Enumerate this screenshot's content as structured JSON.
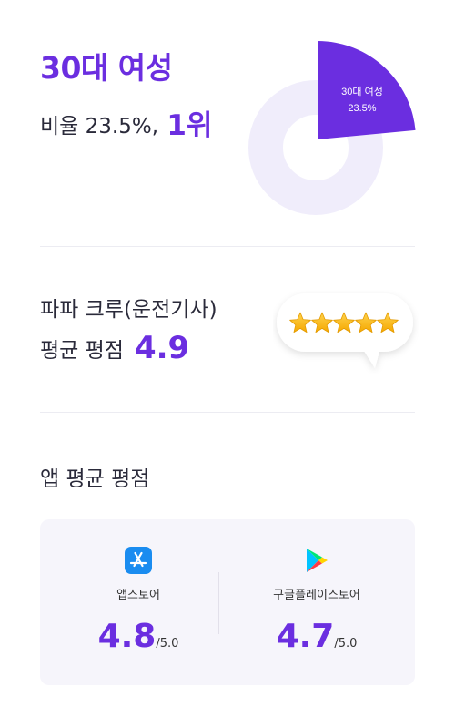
{
  "demographic": {
    "headline": "30대 여성",
    "ratio_label": "비율 23.5%,",
    "rank": "1위",
    "chart": {
      "segment_label": "30대 여성",
      "segment_value": "23.5%",
      "fraction": 0.235,
      "highlight_color": "#6b2ee0",
      "base_color": "#f0edfb"
    }
  },
  "crew": {
    "title": "파파 크루(운전기사)",
    "avg_label": "평균 평점",
    "score": "4.9",
    "stars": 5,
    "star_icon": "star-icon"
  },
  "apps": {
    "title": "앱 평균 평점",
    "stores": [
      {
        "name": "앱스토어",
        "score": "4.8",
        "scale": "/5.0",
        "icon": "app-store-icon",
        "color": "#1a8cf0"
      },
      {
        "name": "구글플레이스토어",
        "score": "4.7",
        "scale": "/5.0",
        "icon": "google-play-icon"
      }
    ]
  },
  "colors": {
    "accent": "#6b2ee0",
    "text": "#2a2a3a",
    "card_bg": "#f6f5fb"
  }
}
